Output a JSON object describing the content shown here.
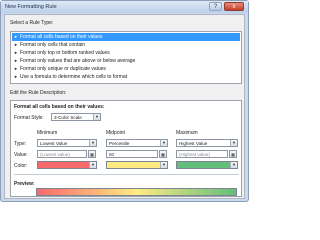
{
  "window": {
    "title": "New Formatting Rule",
    "help_glyph": "?",
    "close_glyph": "x"
  },
  "rule_type": {
    "label": "Select a Rule Type:",
    "items": [
      "Format all cells based on their values",
      "Format only cells that contain",
      "Format only top or bottom ranked values",
      "Format only values that are above or below average",
      "Format only unique or duplicate values",
      "Use a formula to determine which cells to format"
    ],
    "selected_index": 0
  },
  "description": {
    "label": "Edit the Rule Description:",
    "heading": "Format all cells based on their values:",
    "format_style_label": "Format Style:",
    "format_style_value": "3-Color Scale",
    "column_headers": [
      "Minimum",
      "Midpoint",
      "Maximum"
    ],
    "row_labels": [
      "Type:",
      "Value:",
      "Color:"
    ],
    "types": [
      "Lowest Value",
      "Percentile",
      "Highest Value"
    ],
    "values": [
      "(Lowest value)",
      "50",
      "(Highest value)"
    ],
    "colors": [
      "#f8696b",
      "#ffeb84",
      "#63be7b"
    ],
    "preview_label": "Preview:"
  }
}
